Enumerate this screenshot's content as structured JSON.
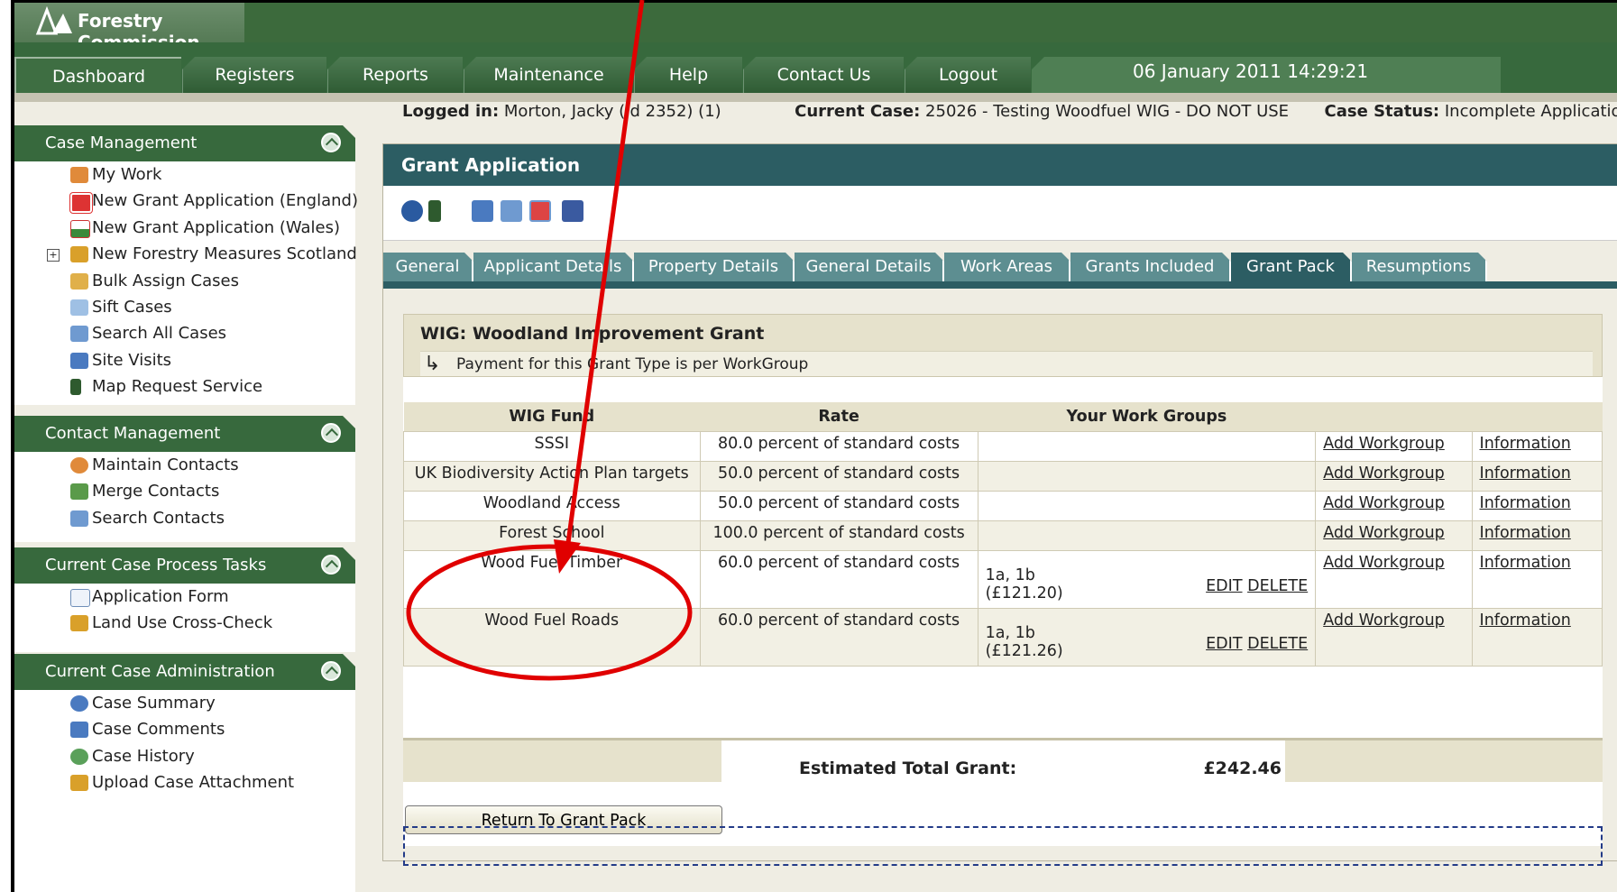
{
  "app": {
    "title": "Forestry Commission"
  },
  "menu": {
    "items": [
      "Dashboard",
      "Registers",
      "Reports",
      "Maintenance",
      "Help",
      "Contact Us",
      "Logout"
    ],
    "datetime": "06 January 2011 14:29:21"
  },
  "sidebar": {
    "case_management": {
      "title": "Case Management",
      "items": [
        "My Work",
        "New Grant Application (England)",
        "New Grant Application (Wales)",
        "New Forestry Measures Scotland",
        "Bulk Assign Cases",
        "Sift Cases",
        "Search All Cases",
        "Site Visits",
        "Map Request Service"
      ]
    },
    "contact_management": {
      "title": "Contact Management",
      "items": [
        "Maintain Contacts",
        "Merge Contacts",
        "Search Contacts"
      ]
    },
    "process_tasks": {
      "title": "Current Case Process Tasks",
      "items": [
        "Application Form",
        "Land Use Cross-Check"
      ]
    },
    "case_admin": {
      "title": "Current Case Administration",
      "items": [
        "Case Summary",
        "Case Comments",
        "Case History",
        "Upload Case Attachment"
      ]
    }
  },
  "status": {
    "logged_in_label": "Logged in:",
    "logged_in_value": "Morton, Jacky (Id 2352) (1)",
    "current_case_label": "Current Case:",
    "current_case_value": "25026 - Testing Woodfuel WIG - DO NOT USE",
    "case_status_label": "Case Status:",
    "case_status_value": "Incomplete Application"
  },
  "panel": {
    "title": "Grant Application",
    "tabs": [
      "General",
      "Applicant Details",
      "Property Details",
      "General Details",
      "Work Areas",
      "Grants Included",
      "Grant Pack",
      "Resumptions"
    ],
    "active_tab": "Grant Pack"
  },
  "grant": {
    "title": "WIG: Woodland Improvement Grant",
    "subtitle": "Payment for this Grant Type is per WorkGroup",
    "headers": [
      "WIG Fund",
      "Rate",
      "Your Work Groups"
    ],
    "rows": [
      {
        "fund": "SSSI",
        "rate": "80.0 percent of standard costs"
      },
      {
        "fund": "UK Biodiversity Action Plan targets",
        "rate": "50.0 percent of standard costs"
      },
      {
        "fund": "Woodland Access",
        "rate": "50.0 percent of standard costs"
      },
      {
        "fund": "Forest School",
        "rate": "100.0 percent of standard costs"
      },
      {
        "fund": "Wood Fuel Timber",
        "rate": "60.0 percent of standard costs",
        "groups": "1a, 1b",
        "amount": "(£121.20)"
      },
      {
        "fund": "Wood Fuel Roads",
        "rate": "60.0 percent of standard costs",
        "groups": "1a, 1b",
        "amount": "(£121.26)"
      }
    ],
    "add_link": "Add Workgroup",
    "info_link": "Information",
    "edit_link": "EDIT",
    "delete_link": "DELETE",
    "total_label": "Estimated Total Grant:",
    "total_value": "£242.46",
    "return_button": "Return To Grant Pack"
  },
  "colors": {
    "brand_green": "#37693d",
    "panel_teal": "#2c5d63",
    "annotation_red": "#e00000"
  }
}
